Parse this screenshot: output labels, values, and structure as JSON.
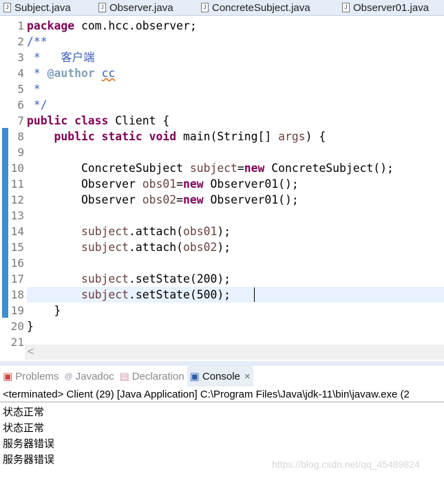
{
  "editor_tabs": [
    {
      "label": "Subject.java",
      "icon": "java-file-icon"
    },
    {
      "label": "Observer.java",
      "icon": "java-file-icon"
    },
    {
      "label": "ConcreteSubject.java",
      "icon": "java-file-icon"
    },
    {
      "label": "Observer01.java",
      "icon": "java-file-icon"
    }
  ],
  "code": {
    "current_line": 18,
    "lines": [
      [
        [
          "kw",
          "package"
        ],
        [
          "t",
          " com.hcc.observer;"
        ]
      ],
      [
        [
          "cm",
          "/**"
        ]
      ],
      [
        [
          "cm",
          " *   客户端"
        ]
      ],
      [
        [
          "cm",
          " * "
        ],
        [
          "tag",
          "@author"
        ],
        [
          "cm",
          " "
        ],
        [
          "cmsp",
          "cc"
        ]
      ],
      [
        [
          "cm",
          " *"
        ]
      ],
      [
        [
          "cm",
          " */"
        ]
      ],
      [
        [
          "kw",
          "public class"
        ],
        [
          "t",
          " Client {"
        ]
      ],
      [
        [
          "t",
          "    "
        ],
        [
          "kw",
          "public static void"
        ],
        [
          "t",
          " main(String[] "
        ],
        [
          "lv",
          "args"
        ],
        [
          "t",
          ") {"
        ]
      ],
      [
        [
          "t",
          ""
        ]
      ],
      [
        [
          "t",
          "        ConcreteSubject "
        ],
        [
          "lv",
          "subject"
        ],
        [
          "t",
          "="
        ],
        [
          "kw",
          "new"
        ],
        [
          "t",
          " ConcreteSubject();"
        ]
      ],
      [
        [
          "t",
          "        Observer "
        ],
        [
          "lv",
          "obs01"
        ],
        [
          "t",
          "="
        ],
        [
          "kw",
          "new"
        ],
        [
          "t",
          " Observer01();"
        ]
      ],
      [
        [
          "t",
          "        Observer "
        ],
        [
          "lv",
          "obs02"
        ],
        [
          "t",
          "="
        ],
        [
          "kw",
          "new"
        ],
        [
          "t",
          " Observer01();"
        ]
      ],
      [
        [
          "t",
          ""
        ]
      ],
      [
        [
          "t",
          "        "
        ],
        [
          "lv",
          "subject"
        ],
        [
          "t",
          ".attach("
        ],
        [
          "lv",
          "obs01"
        ],
        [
          "t",
          ");"
        ]
      ],
      [
        [
          "t",
          "        "
        ],
        [
          "lv",
          "subject"
        ],
        [
          "t",
          ".attach("
        ],
        [
          "lv",
          "obs02"
        ],
        [
          "t",
          ");"
        ]
      ],
      [
        [
          "t",
          ""
        ]
      ],
      [
        [
          "t",
          "        "
        ],
        [
          "lv",
          "subject"
        ],
        [
          "t",
          ".setState(200);"
        ]
      ],
      [
        [
          "t",
          "        "
        ],
        [
          "lv",
          "subject"
        ],
        [
          "t",
          ".setState(500);"
        ]
      ],
      [
        [
          "t",
          "    }"
        ]
      ],
      [
        [
          "t",
          "}"
        ]
      ],
      [
        [
          "t",
          ""
        ]
      ]
    ]
  },
  "view_tabs": [
    {
      "label": "Problems",
      "icon": "problems-icon"
    },
    {
      "label": "Javadoc",
      "icon": "at-icon"
    },
    {
      "label": "Declaration",
      "icon": "declaration-icon"
    },
    {
      "label": "Console",
      "icon": "console-icon",
      "active": true,
      "close": "×"
    }
  ],
  "console": {
    "header": "<terminated> Client (29) [Java Application] C:\\Program Files\\Java\\jdk-11\\bin\\javaw.exe (2",
    "output": [
      "状态正常",
      "状态正常",
      "服务器错误",
      "服务器错误"
    ]
  },
  "watermark": "https://blog.csdn.net/qq_45489824",
  "scroll_left": "<"
}
